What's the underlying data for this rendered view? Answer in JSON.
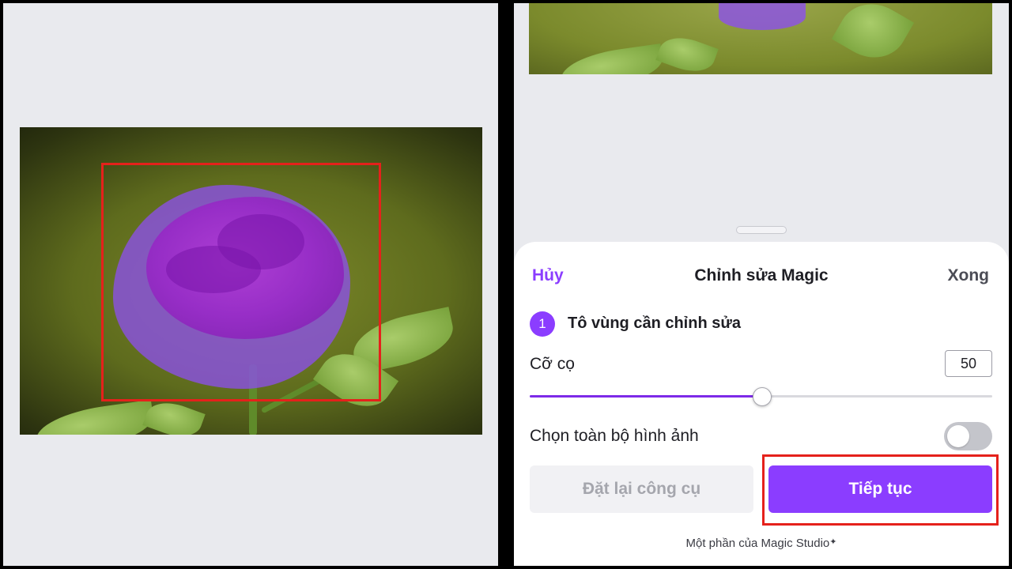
{
  "magic_edit": {
    "cancel_label": "Hủy",
    "title": "Chỉnh sửa Magic",
    "done_label": "Xong",
    "step_number": "1",
    "step_label": "Tô vùng cần chỉnh sửa",
    "brush_size_label": "Cỡ cọ",
    "brush_size_value": "50",
    "brush_slider_fraction": 0.5,
    "select_all_label": "Chọn toàn bộ hình ảnh",
    "select_all_on": false,
    "reset_button_label": "Đặt lại công cụ",
    "continue_button_label": "Tiếp tục",
    "footer_text": "Một phần của Magic Studio",
    "sparkle_icon": "sparkle-icon"
  },
  "colors": {
    "accent": "#8b3dff",
    "highlight": "#e5211b",
    "mask": "#8c50eb"
  }
}
